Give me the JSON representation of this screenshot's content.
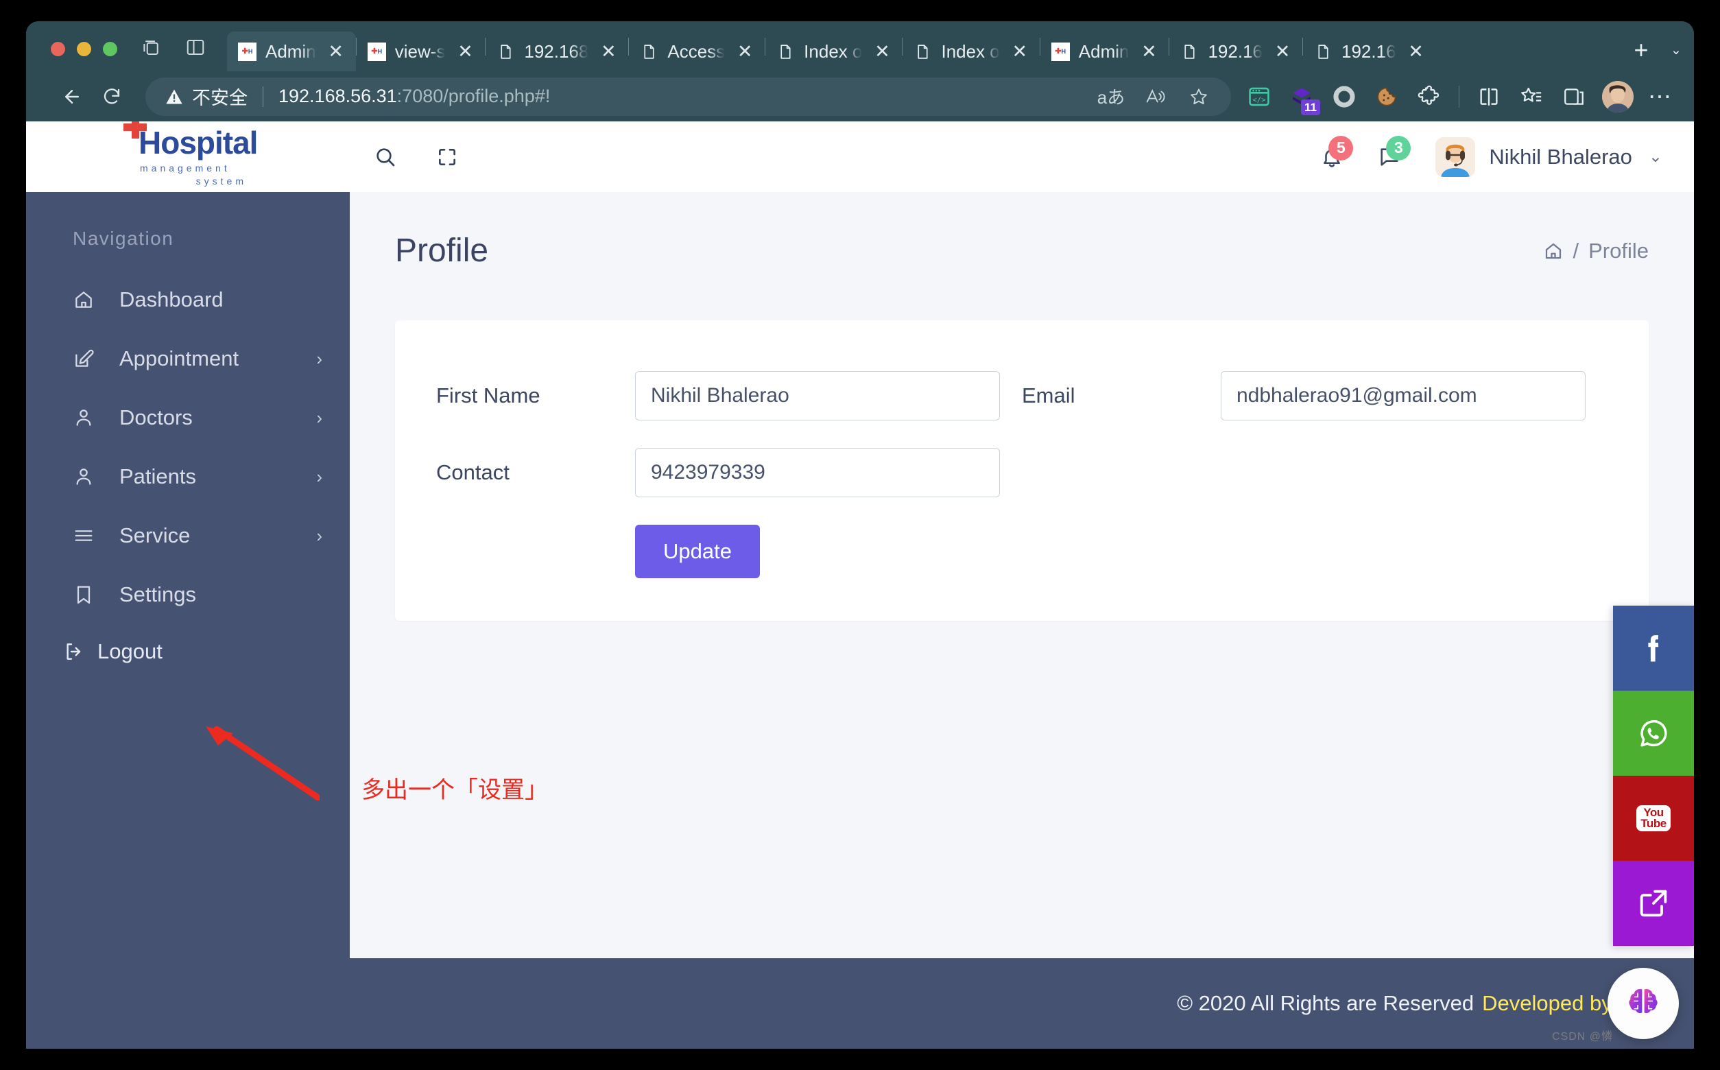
{
  "browser": {
    "tabs": [
      {
        "title": "Admin",
        "favicon": "hospital-favicon",
        "active": true
      },
      {
        "title": "view-s",
        "favicon": "hospital-favicon",
        "active": false
      },
      {
        "title": "192.168",
        "favicon": "page-favicon",
        "active": false
      },
      {
        "title": "Access",
        "favicon": "page-favicon",
        "active": false
      },
      {
        "title": "Index o",
        "favicon": "page-favicon",
        "active": false
      },
      {
        "title": "Index o",
        "favicon": "page-favicon",
        "active": false
      },
      {
        "title": "Admin",
        "favicon": "hospital-favicon",
        "active": false
      },
      {
        "title": "192.16",
        "favicon": "page-favicon",
        "active": false
      },
      {
        "title": "192.16",
        "favicon": "page-favicon",
        "active": false
      }
    ],
    "new_tab_label": "+",
    "tab_list_caret": "⌄",
    "close_label": "✕",
    "security_label": "不安全",
    "url_host": "192.168.56.31",
    "url_path": ":7080/profile.php#!",
    "extension_badge_count": "11",
    "more_label": "⋯"
  },
  "app_header": {
    "logo_main": "Hospital",
    "logo_sub1": "management",
    "logo_sub2": "system",
    "notifications_count": "5",
    "messages_count": "3",
    "user_name": "Nikhil Bhalerao",
    "user_caret": "⌄"
  },
  "sidebar": {
    "title": "Navigation",
    "items": [
      {
        "label": "Dashboard",
        "icon": "home-icon",
        "has_arrow": false
      },
      {
        "label": "Appointment",
        "icon": "edit-icon",
        "has_arrow": true
      },
      {
        "label": "Doctors",
        "icon": "user-icon",
        "has_arrow": true
      },
      {
        "label": "Patients",
        "icon": "user-icon",
        "has_arrow": true
      },
      {
        "label": "Service",
        "icon": "menu-icon",
        "has_arrow": true
      },
      {
        "label": "Settings",
        "icon": "bookmark-icon",
        "has_arrow": false
      }
    ],
    "arrow_glyph": "›",
    "logout_label": "Logout"
  },
  "main": {
    "page_title": "Profile",
    "breadcrumb_separator": "/",
    "breadcrumb_current": "Profile",
    "form": {
      "first_name_label": "First Name",
      "first_name_value": "Nikhil Bhalerao",
      "email_label": "Email",
      "email_value": "ndbhalerao91@gmail.com",
      "contact_label": "Contact",
      "contact_value": "9423979339",
      "update_label": "Update"
    }
  },
  "footer": {
    "copyright": "© 2020 All Rights are Reserved",
    "developed_by": "Developed by Freel"
  },
  "social": [
    {
      "name": "facebook",
      "color": "#3b5998"
    },
    {
      "name": "whatsapp",
      "color": "#4caf2f"
    },
    {
      "name": "youtube",
      "color": "#b31217",
      "label_top": "You",
      "label_bottom": "Tube"
    },
    {
      "name": "share",
      "color": "#9c19d4"
    }
  ],
  "annotation": {
    "text": "多出一个「设置」",
    "color": "#ec2a1f"
  },
  "watermark": "CSDN @憐",
  "colors": {
    "sidebar_bg": "#465271",
    "browser_chrome": "#2e4a52",
    "accent_purple": "#6c5ce7",
    "page_bg": "#f4f6f9",
    "footer_link": "#ffe95c"
  }
}
